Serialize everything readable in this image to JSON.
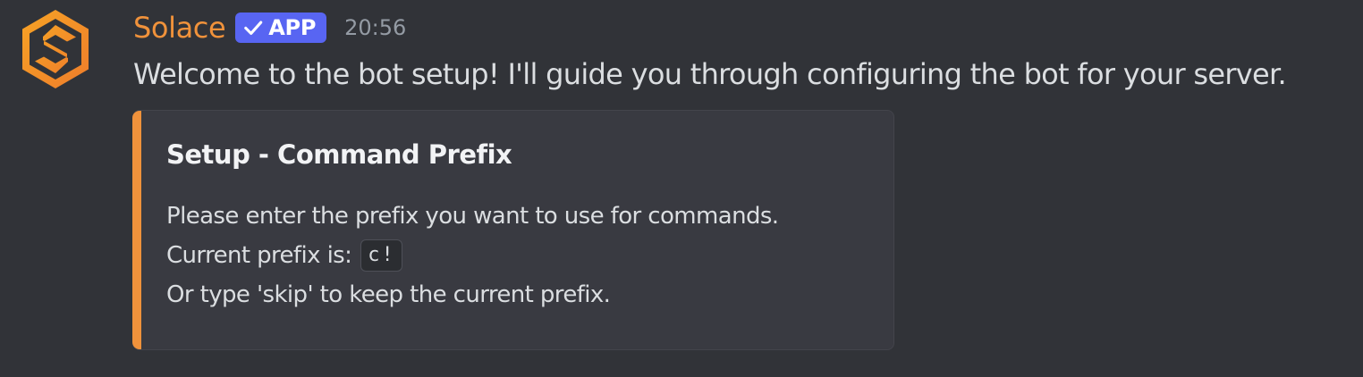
{
  "author": {
    "name": "Solace",
    "name_color": "#f0923b",
    "avatar_icon": "solace-logo-icon",
    "avatar_colors": [
      "#f7a325",
      "#ee7d2b"
    ]
  },
  "badge": {
    "label": "APP",
    "icon": "checkmark-icon",
    "color": "#5865f2"
  },
  "timestamp": "20:56",
  "message": {
    "text": "Welcome to the bot setup! I'll guide you through configuring the bot for your server."
  },
  "embed": {
    "accent_color": "#f0923b",
    "title": "Setup - Command Prefix",
    "line1": "Please enter the prefix you want to use for commands.",
    "line2_prefix": "Current prefix is:",
    "current_prefix": "c!",
    "line3": "Or type 'skip' to keep the current prefix."
  }
}
